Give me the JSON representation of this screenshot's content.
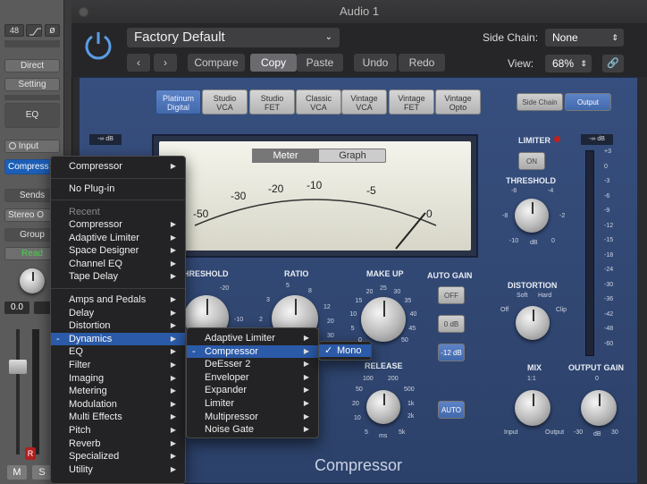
{
  "window": {
    "title": "Audio 1"
  },
  "strip": {
    "top_value": "48",
    "direct": "Direct",
    "setting": "Setting",
    "eq": "EQ",
    "input": "Input",
    "plugin": "Compress",
    "sends": "Sends",
    "output": "Stereo O",
    "group": "Group",
    "read": "Read",
    "volume": "0.0",
    "m": "M",
    "s": "S",
    "r": "R"
  },
  "header": {
    "preset": "Factory Default",
    "compare": "Compare",
    "copy": "Copy",
    "paste": "Paste",
    "undo": "Undo",
    "redo": "Redo",
    "side_chain_label": "Side Chain:",
    "side_chain_value": "None",
    "view_label": "View:",
    "view_value": "68%"
  },
  "plugin": {
    "name": "Compressor",
    "models": [
      {
        "l1": "Platinum",
        "l2": "Digital"
      },
      {
        "l1": "Studio",
        "l2": "VCA"
      },
      {
        "l1": "Studio",
        "l2": "FET"
      },
      {
        "l1": "Classic",
        "l2": "VCA"
      },
      {
        "l1": "Vintage",
        "l2": "VCA"
      },
      {
        "l1": "Vintage",
        "l2": "FET"
      },
      {
        "l1": "Vintage",
        "l2": "Opto"
      }
    ],
    "side_chain_tab": "Side Chain",
    "output_tab": "Output",
    "input_db": "-∞ dB",
    "output_db": "-∞ dB",
    "meter_tab": "Meter",
    "graph_tab": "Graph",
    "meter_scale": [
      "-50",
      "-30",
      "-20",
      "-10",
      "-5",
      "0"
    ],
    "limiter": "LIMITER",
    "on": "ON",
    "threshold_right": "THRESHOLD",
    "threshold_ticks": [
      "-6",
      "-4",
      "-8",
      "-2",
      "-10",
      "0",
      "dB"
    ],
    "distortion": "DISTORTION",
    "dist_opts": [
      "Soft",
      "Hard",
      "Off",
      "Clip"
    ],
    "mix": "MIX",
    "mix_ticks": [
      "1:1",
      "Input",
      "Output"
    ],
    "output_gain": "OUTPUT GAIN",
    "og_ticks": [
      "0",
      "-30",
      "30",
      "dB"
    ],
    "threshold_left": "HRESHOLD",
    "ratio": "RATIO",
    "make_up": "MAKE UP",
    "auto_gain": "AUTO GAIN",
    "ag_off": "OFF",
    "ag_0": "0 dB",
    "ag_12": "-12 dB",
    "auto": "AUTO",
    "release": "RELEASE",
    "makeup_ticks": [
      "0",
      "5",
      "10",
      "15",
      "20",
      "25",
      "30",
      "35",
      "40",
      "45",
      "50"
    ],
    "release_ticks": [
      "100",
      "200",
      "50",
      "500",
      "20",
      "1k",
      "10",
      "2k",
      "5",
      "5k",
      "ms"
    ],
    "ratio_ticks": [
      "5",
      "8",
      "3",
      "12",
      "2",
      "20",
      "30"
    ],
    "thr_ticks": [
      "-20",
      "-10"
    ],
    "right_scale": [
      "+3",
      "0",
      "-3",
      "-6",
      "-9",
      "-12",
      "-15",
      "-18",
      "-24",
      "-30",
      "-36",
      "-42",
      "-48",
      "-60"
    ]
  },
  "menu_main": {
    "top": "Compressor",
    "no_plugin": "No Plug-in",
    "recent_header": "Recent",
    "recent": [
      "Compressor",
      "Adaptive Limiter",
      "Space Designer",
      "Channel EQ",
      "Tape Delay"
    ],
    "categories": [
      "Amps and Pedals",
      "Delay",
      "Distortion",
      "Dynamics",
      "EQ",
      "Filter",
      "Imaging",
      "Metering",
      "Modulation",
      "Multi Effects",
      "Pitch",
      "Reverb",
      "Specialized",
      "Utility"
    ]
  },
  "menu_dynamics": {
    "items": [
      "Adaptive Limiter",
      "Compressor",
      "DeEsser 2",
      "Enveloper",
      "Expander",
      "Limiter",
      "Multipressor",
      "Noise Gate"
    ]
  },
  "menu_format": {
    "items": [
      "Mono"
    ]
  }
}
